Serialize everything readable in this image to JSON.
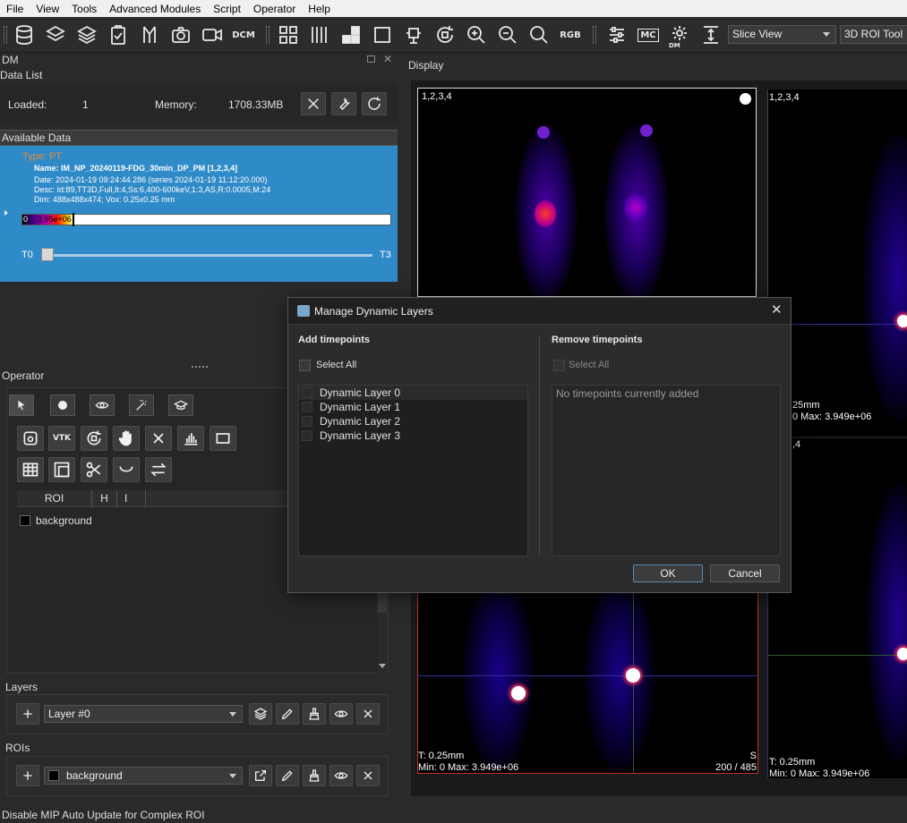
{
  "menu": [
    "File",
    "View",
    "Tools",
    "Advanced Modules",
    "Script",
    "Operator",
    "Help"
  ],
  "toolbar": {
    "vtk_label": "VTK",
    "dcm_label": "DCM",
    "rgb_label": "RGB",
    "mc_label": "MC",
    "dm_label": "DM",
    "view_combo": "Slice View",
    "tool_combo": "3D ROI Tool"
  },
  "dm_panel": {
    "title": "DM",
    "data_list_title": "Data List",
    "loaded_label": "Loaded:",
    "loaded_value": "1",
    "memory_label": "Memory:",
    "memory_value": "1708.33MB",
    "available_title": "Available Data",
    "item": {
      "type": "Type: PT",
      "name": "Name: IM_NP_20240119-FDG_30min_DP_PM [1,2,3,4]",
      "date": "Date: 2024-01-19 09:24:44.286 (series 2024-01-19 11:12:20.000)",
      "desc": "Desc: Id:89,TT3D,Full,It:4,Ss:6,400-600keV,1:3,AS,R:0.0005,M:24",
      "dim": "Dim: 488x488x474; Vox: 0.25x0.25 mm",
      "colorbar_min": "0",
      "colorbar_max": "3.95e+06",
      "t_start": "T0",
      "t_end": "T3"
    }
  },
  "operator": {
    "title": "Operator",
    "roi_columns": [
      "ROI",
      "H",
      "I"
    ],
    "roi_rows": [
      "background"
    ]
  },
  "layers": {
    "title": "Layers",
    "current": "Layer #0"
  },
  "rois": {
    "title": "ROIs",
    "current": "background"
  },
  "display": {
    "title": "Display",
    "view_tl_label": "1,2,3,4",
    "view_tr_label": "1,2,3,4",
    "view_br_label": ",4",
    "view_tr_info1": "25mm",
    "view_tr_info2": "0 Max: 3.949e+06",
    "view_bl_info1": "T: 0.25mm",
    "view_bl_info2": "Min: 0 Max: 3.949e+06",
    "view_bl_orient": "S",
    "view_bl_slice": "200 / 485",
    "view_br_info1": "T: 0.25mm",
    "view_br_info2": "Min: 0 Max: 3.949e+06"
  },
  "dialog": {
    "title": "Manage Dynamic Layers",
    "add_title": "Add timepoints",
    "remove_title": "Remove timepoints",
    "select_all": "Select All",
    "add_items": [
      "Dynamic Layer 0",
      "Dynamic Layer 1",
      "Dynamic Layer 2",
      "Dynamic Layer 3"
    ],
    "empty_text": "No timepoints currently added",
    "ok": "OK",
    "cancel": "Cancel"
  },
  "status": "Disable MIP Auto Update for Complex ROI"
}
